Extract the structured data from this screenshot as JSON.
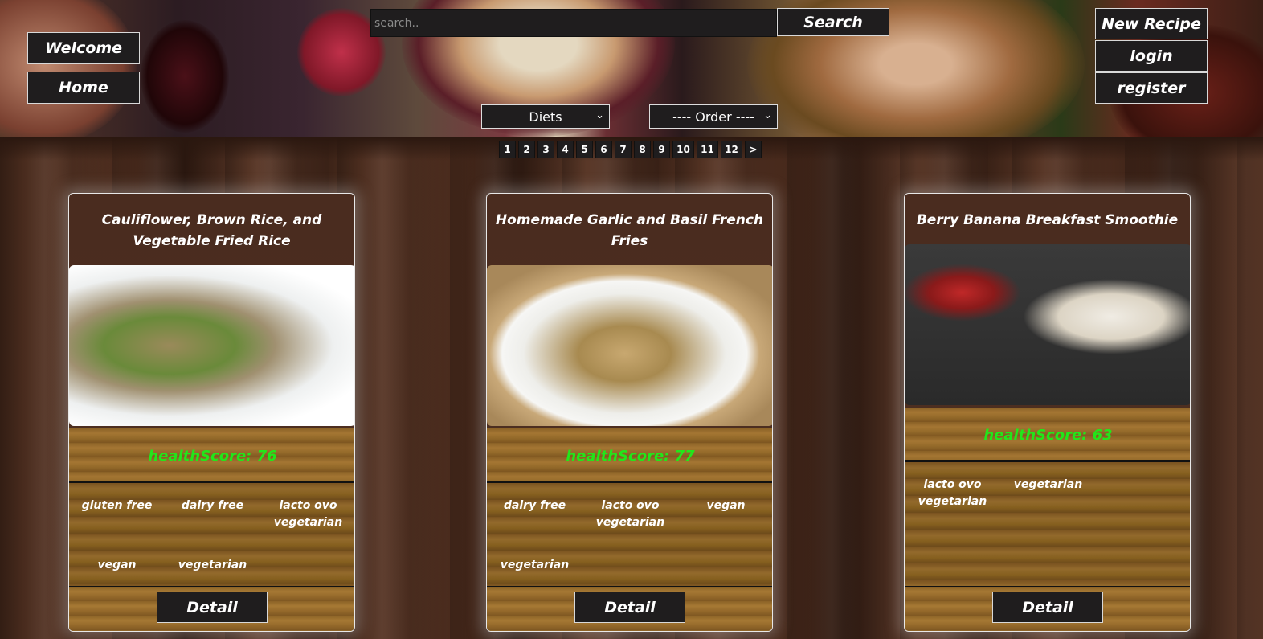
{
  "header": {
    "welcome_label": "Welcome",
    "home_label": "Home",
    "search_placeholder": "search..",
    "search_button": "Search",
    "new_recipe_label": "New Recipe",
    "login_label": "login",
    "register_label": "register",
    "diets_select": "Diets",
    "order_select": "---- Order ----"
  },
  "pagination": {
    "pages": [
      "1",
      "2",
      "3",
      "4",
      "5",
      "6",
      "7",
      "8",
      "9",
      "10",
      "11",
      "12"
    ],
    "next_label": ">"
  },
  "recipes": [
    {
      "title": "Cauliflower, Brown Rice, and Vegetable Fried Rice",
      "health_label": "healthScore: 76",
      "diets": [
        "gluten free",
        "dairy free",
        "lacto ovo vegetarian",
        "vegan",
        "vegetarian"
      ],
      "detail_label": "Detail"
    },
    {
      "title": "Homemade Garlic and Basil French Fries",
      "health_label": "healthScore: 77",
      "diets": [
        "dairy free",
        "lacto ovo vegetarian",
        "vegan",
        "vegetarian"
      ],
      "detail_label": "Detail"
    },
    {
      "title": "Berry Banana Breakfast Smoothie",
      "health_label": "healthScore: 63",
      "diets": [
        "lacto ovo vegetarian",
        "vegetarian"
      ],
      "detail_label": "Detail"
    }
  ],
  "colors": {
    "button_bg": "#1f1d1e",
    "health_score": "#22e61a"
  }
}
